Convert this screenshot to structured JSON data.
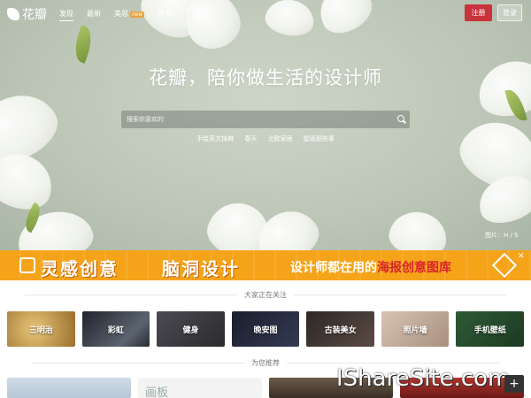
{
  "nav": {
    "logo_text": "花瓣",
    "items": [
      {
        "label": "发现"
      },
      {
        "label": "最新"
      },
      {
        "label": "美思"
      },
      {
        "label": "教育"
      }
    ],
    "new_badge": "new",
    "more": "•••",
    "register": "注册",
    "login": "登录"
  },
  "hero": {
    "slogan": "花瓣，陪你做生活的设计师",
    "search_placeholder": "搜索你喜欢的",
    "hot_words": [
      "手绘英文抹麻",
      "春天",
      "北欧家居",
      "壁纸那些事"
    ],
    "credit": "图片：H / S"
  },
  "banner": {
    "text1": "灵感创意",
    "text2": "脑洞设计",
    "text3_prefix": "设计师都在用的",
    "text3_highlight": "海报创意图库",
    "close": "✕"
  },
  "following": {
    "title": "大家正在关注",
    "tiles": [
      {
        "label": "三明治",
        "color": "#c9a04a"
      },
      {
        "label": "彩虹",
        "color": "#2c2f3a"
      },
      {
        "label": "健身",
        "color": "#3a3a40"
      },
      {
        "label": "晚安图",
        "color": "#1e2233"
      },
      {
        "label": "古装美女",
        "color": "#3b3534"
      },
      {
        "label": "照片墙",
        "color": "#c8b4a6"
      },
      {
        "label": "手机壁纸",
        "color": "#2e4a33"
      }
    ]
  },
  "recommend": {
    "title": "为您推荐",
    "card_label": "画板"
  },
  "watermark": "IShareSite.com",
  "plus": "+"
}
